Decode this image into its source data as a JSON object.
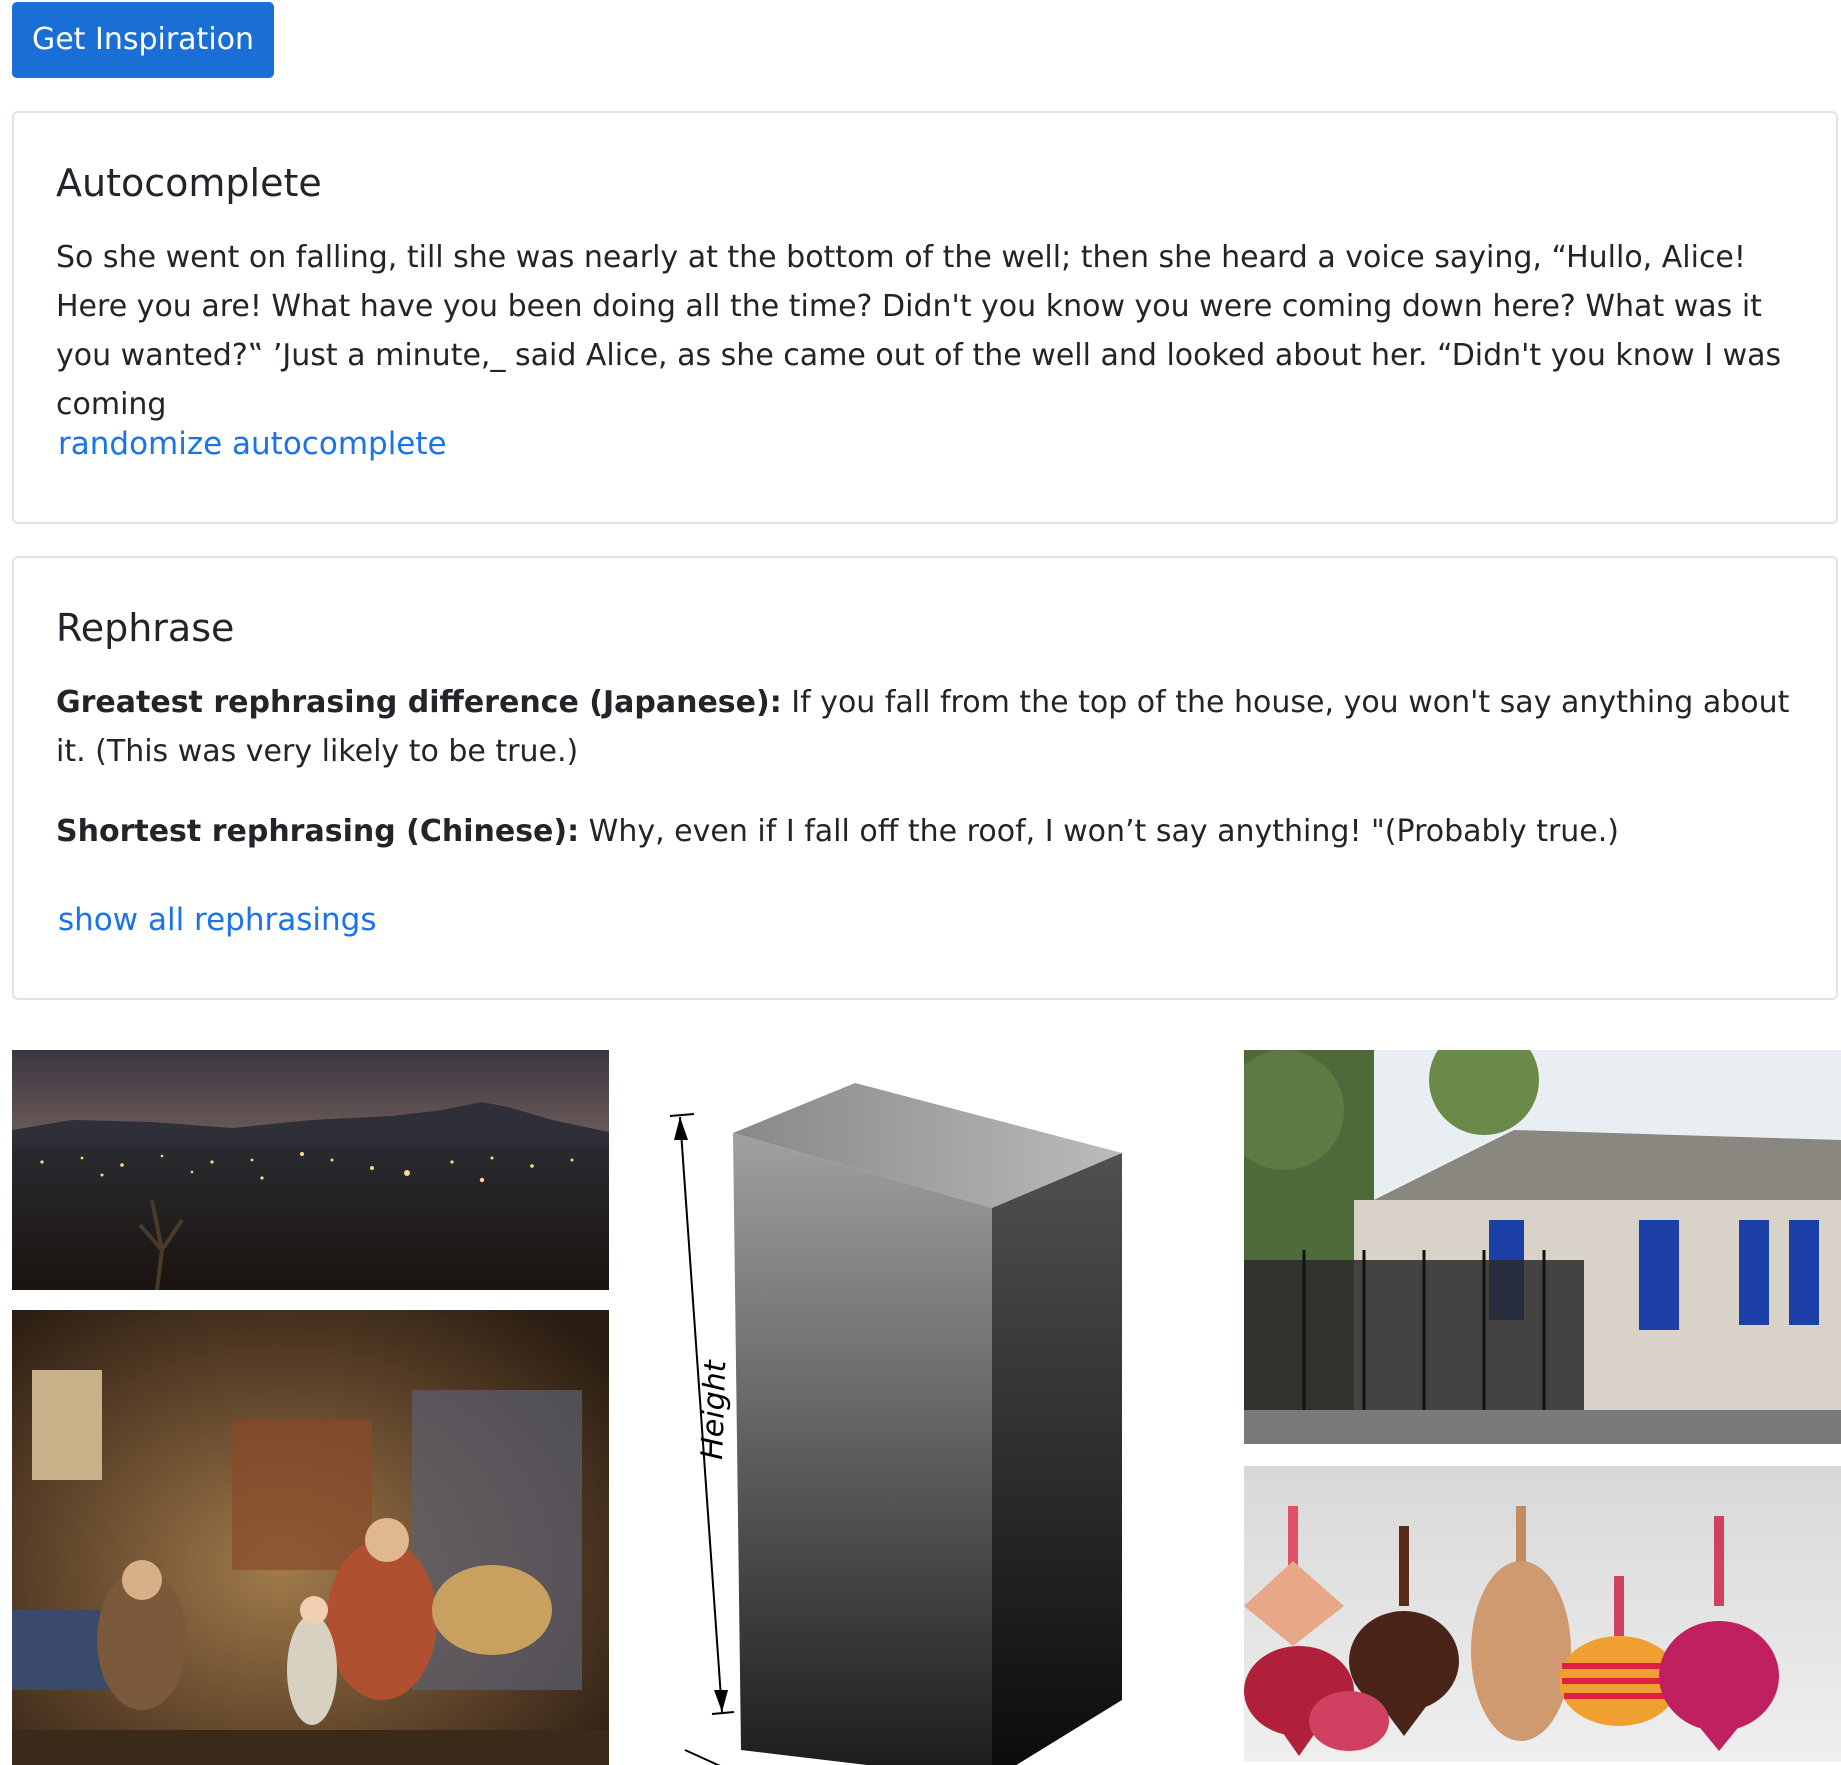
{
  "toolbar": {
    "inspiration_label": "Get Inspiration"
  },
  "autocomplete": {
    "title": "Autocomplete",
    "text": "So she went on falling, till she was nearly at the bottom of the well; then she heard a voice saying, “Hullo, Alice! Here you are! What have you been doing all the time? Didn't you know you were coming down here? What was it you wanted?‟ ’Just a minute,_ said Alice, as she came out of the well and looked about her. “Didn't you know I was coming",
    "link_label": "randomize autocomplete"
  },
  "rephrase": {
    "title": "Rephrase",
    "items": [
      {
        "label": "Greatest rephrasing difference (Japanese):",
        "text": " If you fall from the top of the house, you won't say anything about it. (This was very likely to be true.)"
      },
      {
        "label": "Shortest rephrasing (Chinese):",
        "text": " Why, even if I fall off the roof, I won’t say anything! \"(Probably true.)"
      }
    ],
    "link_label": "show all rephrasings"
  },
  "gallery": {
    "box_caption": "Height"
  }
}
